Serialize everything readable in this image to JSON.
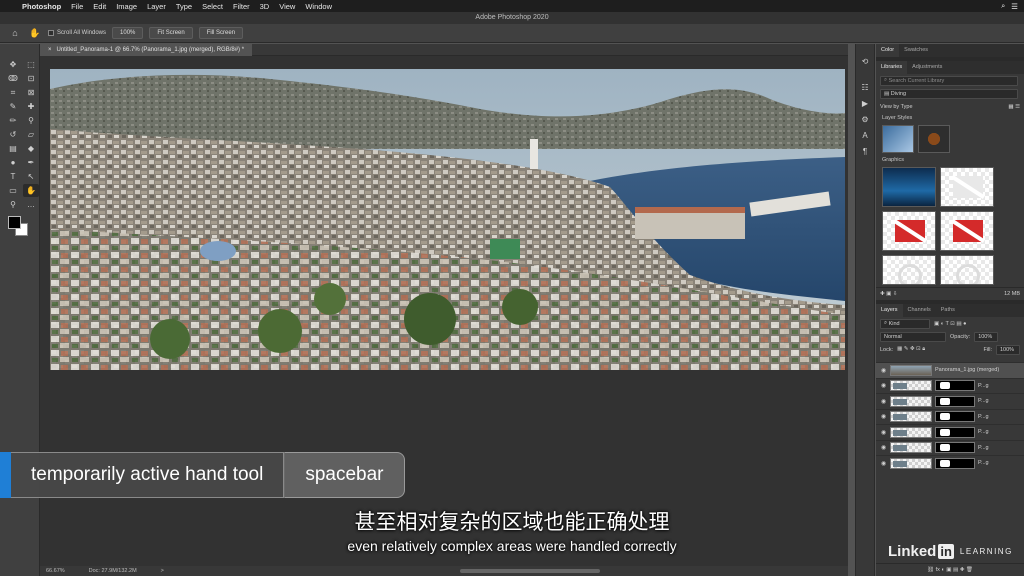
{
  "menubar": {
    "app": "Photoshop",
    "items": [
      "File",
      "Edit",
      "Image",
      "Layer",
      "Type",
      "Select",
      "Filter",
      "3D",
      "View",
      "Window"
    ]
  },
  "window_title": "Adobe Photoshop 2020",
  "options_bar": {
    "scroll_all_windows": "Scroll All Windows",
    "zoom_100": "100%",
    "fit_screen": "Fit Screen",
    "fill_screen": "Fill Screen"
  },
  "document_tab": {
    "label": "Untitled_Panorama-1 @ 66.7% (Panorama_1.jpg (merged), RGB/8#) *",
    "close": "×"
  },
  "status_bar": {
    "zoom": "66.67%",
    "doc": "Doc: 27.9M/132.2M",
    "arrow": ">"
  },
  "panels": {
    "top_tabs": [
      "Color",
      "Swatches"
    ],
    "library_tabs": [
      "Libraries",
      "Adjustments"
    ],
    "search_placeholder": "Search Current Library",
    "library_name": "Diving",
    "view_by": "View by Type",
    "layer_styles_label": "Layer Styles",
    "graphics_label": "Graphics",
    "library_size": "12 MB",
    "layers_tabs": [
      "Layers",
      "Channels",
      "Paths"
    ],
    "kind": "Kind",
    "blend_mode": "Normal",
    "opacity_label": "Opacity:",
    "opacity_value": "100%",
    "lock_label": "Lock:",
    "fill_label": "Fill:",
    "fill_value": "100%",
    "layers": [
      {
        "name": "Panorama_1.jpg (merged)"
      },
      {
        "name": "P...g"
      },
      {
        "name": "P...g"
      },
      {
        "name": "P...g"
      },
      {
        "name": "P...g"
      },
      {
        "name": "P...g"
      },
      {
        "name": "P...g"
      }
    ]
  },
  "lower_third": {
    "title": "temporarily active hand tool",
    "shortcut": "spacebar"
  },
  "subtitles": {
    "zh": "甚至相对复杂的区域也能正确处理",
    "en": "even relatively complex areas were handled correctly"
  },
  "logo": {
    "linked": "Linked",
    "in": "in",
    "learning": "LEARNING"
  },
  "colors": {
    "accent_blue": "#1f7fd6",
    "fg_color": "#000000",
    "bg_color": "#ffffff"
  }
}
